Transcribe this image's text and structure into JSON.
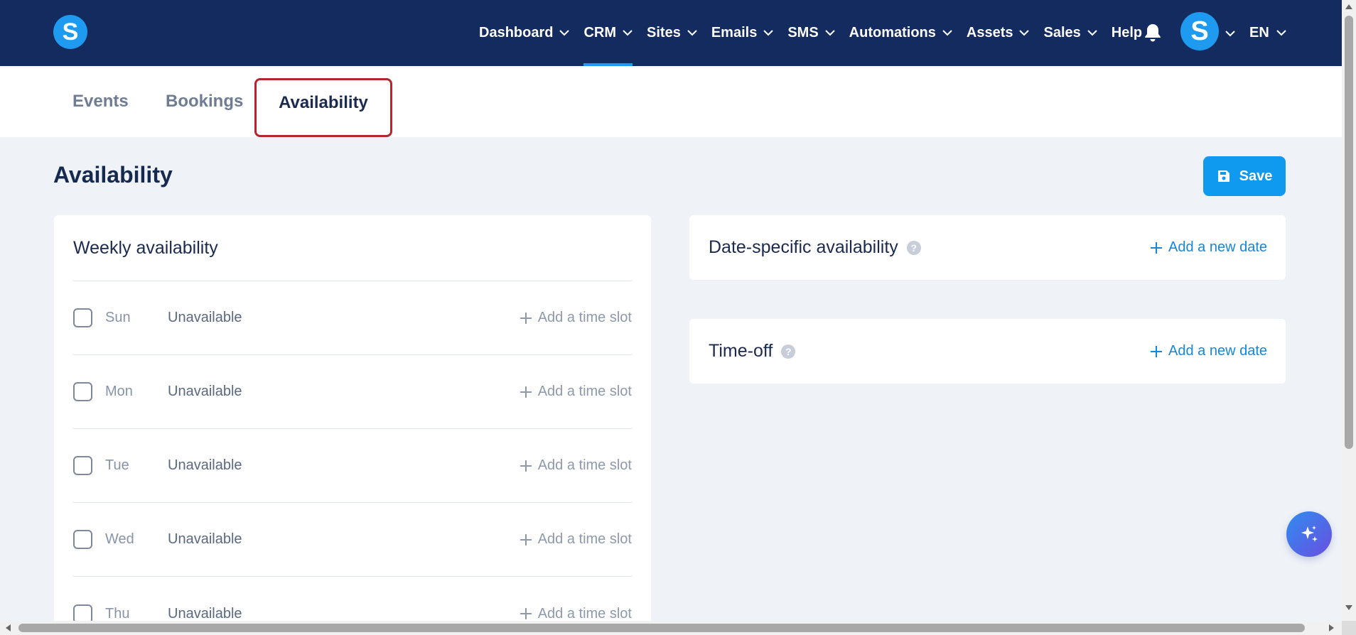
{
  "nav": {
    "items": [
      {
        "label": "Dashboard",
        "dropdown": true
      },
      {
        "label": "CRM",
        "dropdown": true,
        "active": true
      },
      {
        "label": "Sites",
        "dropdown": true
      },
      {
        "label": "Emails",
        "dropdown": true
      },
      {
        "label": "SMS",
        "dropdown": true
      },
      {
        "label": "Automations",
        "dropdown": true
      },
      {
        "label": "Assets",
        "dropdown": true
      },
      {
        "label": "Sales",
        "dropdown": true
      },
      {
        "label": "Help",
        "dropdown": false
      }
    ],
    "language": "EN",
    "logo_letter": "S",
    "avatar_letter": "S"
  },
  "subtabs": {
    "events": "Events",
    "bookings": "Bookings",
    "availability": "Availability",
    "active": "availability"
  },
  "page": {
    "title": "Availability",
    "save_label": "Save"
  },
  "weekly": {
    "title": "Weekly availability",
    "add_slot_label": "Add a time slot",
    "days": [
      {
        "name": "Sun",
        "status": "Unavailable",
        "checked": false
      },
      {
        "name": "Mon",
        "status": "Unavailable",
        "checked": false
      },
      {
        "name": "Tue",
        "status": "Unavailable",
        "checked": false
      },
      {
        "name": "Wed",
        "status": "Unavailable",
        "checked": false
      },
      {
        "name": "Thu",
        "status": "Unavailable",
        "checked": false
      }
    ]
  },
  "date_specific": {
    "title": "Date-specific availability",
    "add_label": "Add a new date"
  },
  "time_off": {
    "title": "Time-off",
    "add_label": "Add a new date"
  },
  "help_glyph": "?",
  "colors": {
    "nav_bg": "#132b5e",
    "accent": "#1e9bf0",
    "page_bg": "#eff3f8",
    "highlight_border": "#b3262d",
    "link": "#1786d6"
  }
}
